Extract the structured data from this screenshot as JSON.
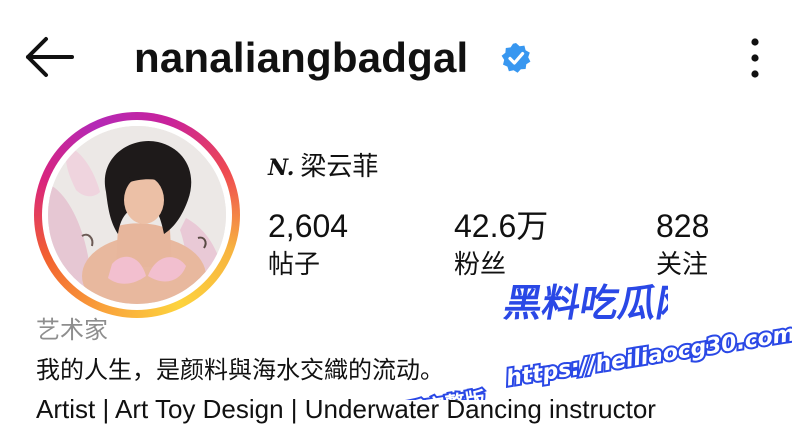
{
  "header": {
    "username": "nanaliangbadgal",
    "back_icon": "arrow-left-icon",
    "verified_icon": "verified-badge-icon",
    "more_icon": "more-vertical-icon"
  },
  "profile": {
    "display_name": "梁云菲",
    "name_mark": "N.",
    "avatar_icon": "avatar-photo",
    "stats": [
      {
        "value": "2,604",
        "label": "帖子"
      },
      {
        "value": "42.6万",
        "label": "粉丝"
      },
      {
        "value": "828",
        "label": "关注"
      }
    ],
    "category": "艺术家",
    "bio_line1": "我的人生，是颜料與海水交織的流动。",
    "bio_line2": "Artist | Art Toy Design  | Underwater Dancing instructor"
  },
  "watermark": {
    "logo_text": "黑料吃瓜网",
    "caption": "看完整版",
    "url": "https://heiliaocg30.com"
  },
  "colors": {
    "verified": "#3897f0",
    "category_text": "#8e8e8e",
    "watermark_blue": "#2a48e6",
    "ring_start": "#f9a23b",
    "ring_end": "#b429b6"
  }
}
